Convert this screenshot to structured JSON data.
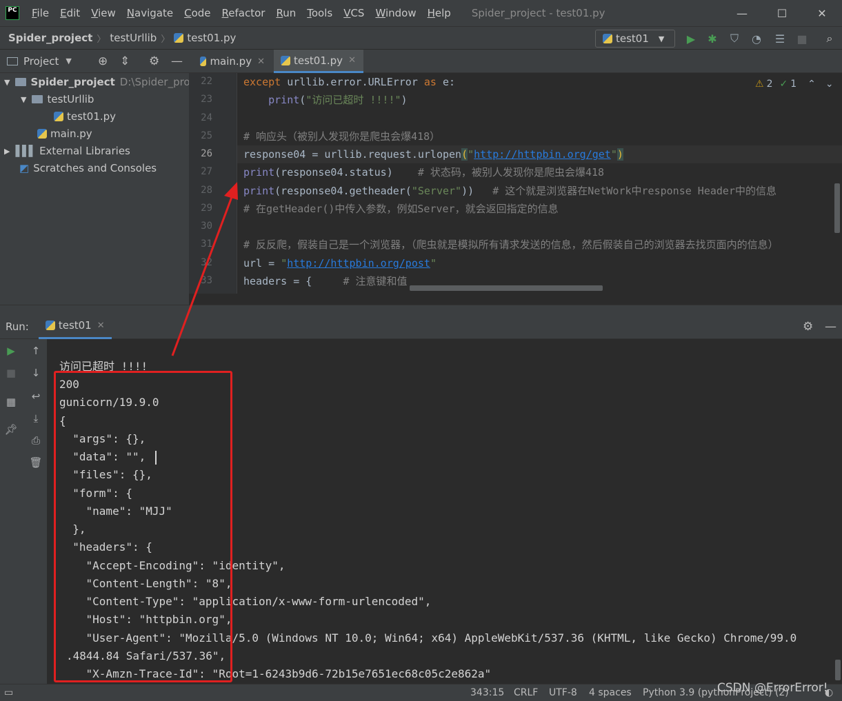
{
  "menu": {
    "items": [
      "File",
      "Edit",
      "View",
      "Navigate",
      "Code",
      "Refactor",
      "Run",
      "Tools",
      "VCS",
      "Window",
      "Help"
    ],
    "window_title": "Spider_project - test01.py"
  },
  "nav": {
    "crumbs": [
      "Spider_project",
      "testUrllib",
      "test01.py"
    ],
    "run_config": "test01"
  },
  "project": {
    "header": "Project",
    "tree": [
      {
        "label": "Spider_project",
        "hint": "D:\\Spider_proj"
      },
      {
        "label": "testUrllib"
      },
      {
        "label": "test01.py"
      },
      {
        "label": "main.py"
      },
      {
        "label": "External Libraries"
      },
      {
        "label": "Scratches and Consoles"
      }
    ]
  },
  "editor": {
    "tabs": [
      "main.py",
      "test01.py"
    ],
    "inspection": {
      "warnings": "2",
      "ok": "1"
    },
    "line_numbers": [
      "22",
      "23",
      "24",
      "25",
      "26",
      "27",
      "28",
      "29",
      "30",
      "31",
      "32",
      "33"
    ],
    "current_line": "26"
  },
  "run": {
    "label": "Run:",
    "tab": "test01",
    "output": [
      "访问已超时 !!!!",
      "200",
      "gunicorn/19.9.0",
      "{",
      "  \"args\": {},",
      "  \"data\": \"\",",
      "  \"files\": {},",
      "  \"form\": {",
      "    \"name\": \"MJJ\"",
      "  },",
      "  \"headers\": {",
      "    \"Accept-Encoding\": \"identity\",",
      "    \"Content-Length\": \"8\",",
      "    \"Content-Type\": \"application/x-www-form-urlencoded\",",
      "    \"Host\": \"httpbin.org\",",
      "    \"User-Agent\": \"Mozilla/5.0 (Windows NT 10.0; Win64; x64) AppleWebKit/537.36 (KHTML, like Gecko) Chrome/99.0",
      ".4844.84 Safari/537.36\",",
      "    \"X-Amzn-Trace-Id\": \"Root=1-6243b9d6-72b15e7651ec68c05c2e862a\""
    ]
  },
  "status": {
    "position": "343:15",
    "line_sep": "CRLF",
    "encoding": "UTF-8",
    "indent": "4 spaces",
    "interpreter": "Python 3.9 (pythonProject) (2)"
  },
  "watermark": "CSDN @ErrorError!",
  "colors": {
    "accent": "#4a88c7",
    "run_green": "#499c54",
    "annotation_red": "#e02020"
  }
}
